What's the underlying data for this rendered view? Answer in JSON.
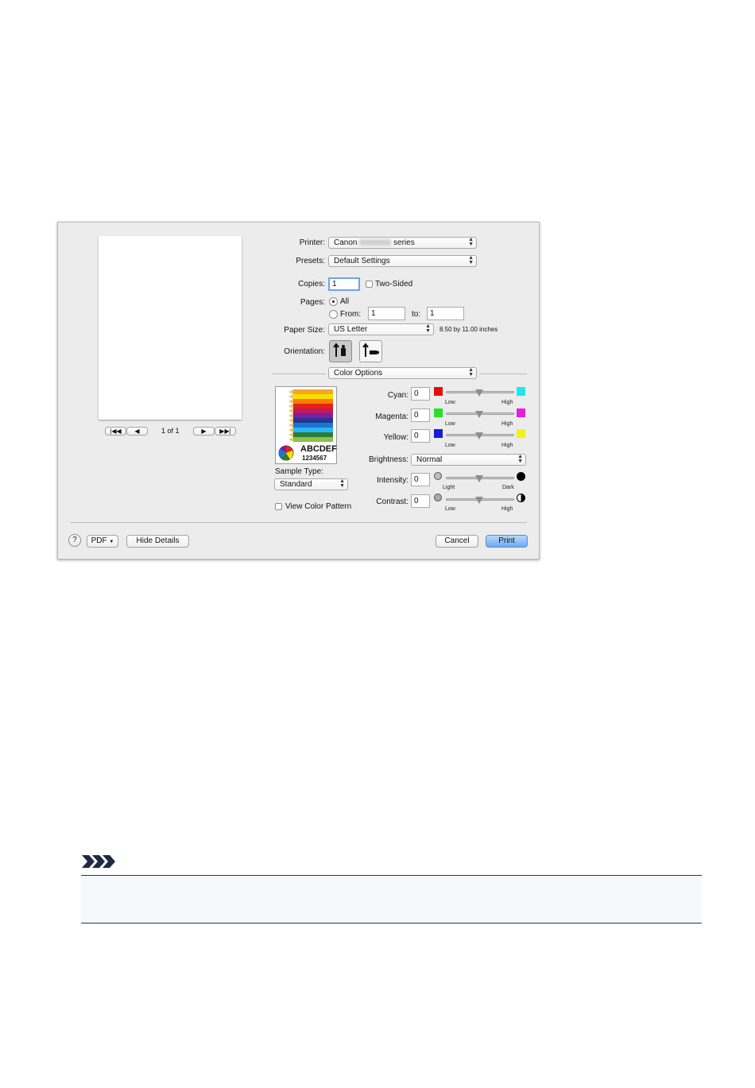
{
  "dialog": {
    "printer_label": "Printer:",
    "printer_value_prefix": "Canon",
    "printer_value_suffix": "series",
    "presets_label": "Presets:",
    "presets_value": "Default Settings",
    "copies_label": "Copies:",
    "copies_value": "1",
    "two_sided_label": "Two-Sided",
    "pages_label": "Pages:",
    "pages_all_label": "All",
    "pages_from_label": "From:",
    "pages_from_value": "1",
    "pages_to_label": "to:",
    "pages_to_value": "1",
    "paper_size_label": "Paper Size:",
    "paper_size_value": "US Letter",
    "paper_size_dims": "8.50 by 11.00 inches",
    "orientation_label": "Orientation:",
    "panel_value": "Color Options",
    "preview_page_count": "1 of 1",
    "sample_text_letters": "ABCDEF",
    "sample_text_numbers": "1234567",
    "sample_type_label": "Sample Type:",
    "sample_type_value": "Standard",
    "view_color_pattern_label": "View Color Pattern",
    "cyan_label": "Cyan:",
    "magenta_label": "Magenta:",
    "yellow_label": "Yellow:",
    "brightness_label": "Brightness:",
    "brightness_value": "Normal",
    "intensity_label": "Intensity:",
    "contrast_label": "Contrast:",
    "cyan_value": "0",
    "magenta_value": "0",
    "yellow_value": "0",
    "intensity_value": "0",
    "contrast_value": "0",
    "low_label": "Low",
    "high_label": "High",
    "light_label": "Light",
    "dark_label": "Dark",
    "help_symbol": "?",
    "pdf_label": "PDF",
    "hide_details_label": "Hide Details",
    "cancel_label": "Cancel",
    "print_label": "Print",
    "slider_level_percent": 50
  },
  "colors": {
    "cyan_low": "#e30f0f",
    "cyan_high": "#22e6ee",
    "magenta_low": "#27e02a",
    "magenta_high": "#e61fd8",
    "yellow_low": "#1b1bd6",
    "yellow_high": "#f2f21b",
    "accent_blue": "#6faaf2"
  },
  "note": {
    "icon": "note-chevrons-icon"
  }
}
